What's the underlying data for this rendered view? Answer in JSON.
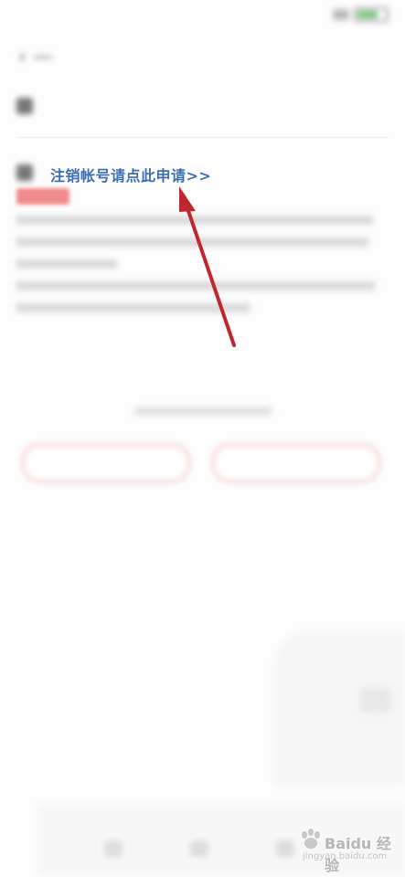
{
  "deregister_link": "注销帐号请点此申请>>",
  "watermark": {
    "name": "Baidu 经验",
    "url": "jingyan.baidu.com"
  },
  "colors": {
    "link": "#3d6fb0",
    "arrow": "#c0272d",
    "accent_red": "#e06060"
  },
  "icons": [
    "back-arrow-icon",
    "signal-icon",
    "battery-icon",
    "baidu-paw-icon",
    "annotation-arrow"
  ]
}
